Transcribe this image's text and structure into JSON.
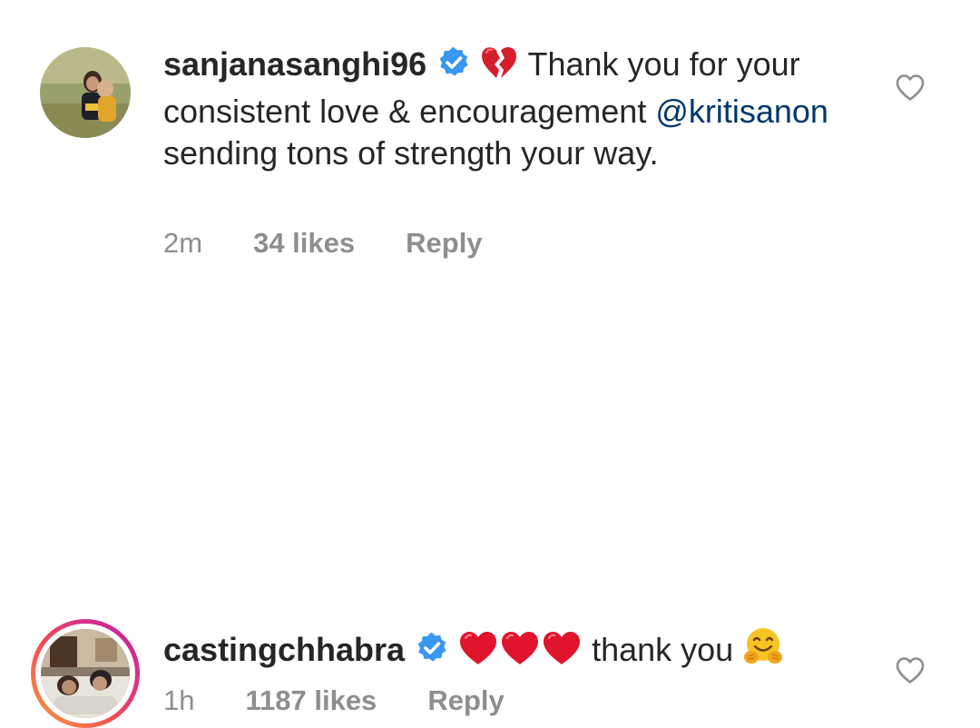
{
  "comments": [
    {
      "username": "sanjanasanghi96",
      "verified": true,
      "emoji": "broken-heart",
      "text_before": " Thank you for your consistent love & encouragement ",
      "mention": "@kritisanon",
      "text_after": " sending tons of strength your way.",
      "time": "2m",
      "likes": "34 likes",
      "reply": "Reply",
      "has_story": false
    },
    {
      "username": "castingchhabra",
      "verified": true,
      "emoji_prefix": [
        "red-heart",
        "red-heart",
        "red-heart"
      ],
      "text": " thank you ",
      "emoji_suffix": "hugging-face",
      "time": "1h",
      "likes": "1187 likes",
      "reply": "Reply",
      "has_story": true
    }
  ],
  "colors": {
    "text": "#262626",
    "secondary": "#8e8e8e",
    "mention": "#00376b",
    "verified": "#3897f0",
    "heart_red": "#e0142c"
  },
  "icons": {
    "like": "heart-outline-icon",
    "verified": "verified-badge-icon"
  }
}
